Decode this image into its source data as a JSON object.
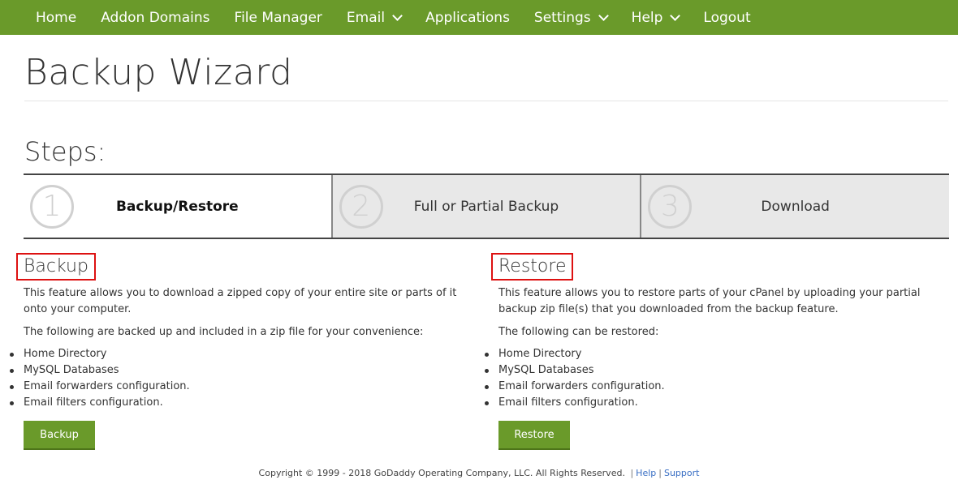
{
  "nav": {
    "items": [
      {
        "label": "Home",
        "dropdown": false
      },
      {
        "label": "Addon Domains",
        "dropdown": false
      },
      {
        "label": "File Manager",
        "dropdown": false
      },
      {
        "label": "Email",
        "dropdown": true
      },
      {
        "label": "Applications",
        "dropdown": false
      },
      {
        "label": "Settings",
        "dropdown": true
      },
      {
        "label": "Help",
        "dropdown": true
      },
      {
        "label": "Logout",
        "dropdown": false
      }
    ],
    "color": "#6a9a2a"
  },
  "page": {
    "title": "Backup Wizard",
    "steps_title": "Steps:"
  },
  "steps": [
    {
      "number": "1",
      "label": "Backup/Restore",
      "active": true
    },
    {
      "number": "2",
      "label": "Full or Partial Backup",
      "active": false
    },
    {
      "number": "3",
      "label": "Download",
      "active": false
    }
  ],
  "backup": {
    "title": "Backup",
    "description": "This feature allows you to download a zipped copy of your entire site or parts of it onto your computer.",
    "subheading": "The following are backed up and included in a zip file for your convenience:",
    "items": [
      "Home Directory",
      "MySQL Databases",
      "Email forwarders configuration.",
      "Email filters configuration."
    ],
    "button_label": "Backup"
  },
  "restore": {
    "title": "Restore",
    "description": "This feature allows you to restore parts of your cPanel by uploading your partial backup zip file(s) that you downloaded from the backup feature.",
    "subheading": "The following can be restored:",
    "items": [
      "Home Directory",
      "MySQL Databases",
      "Email forwarders configuration.",
      "Email filters configuration."
    ],
    "button_label": "Restore"
  },
  "footer": {
    "copyright": "Copyright © 1999 - 2018 GoDaddy Operating Company, LLC. All Rights Reserved.",
    "help_link": "Help",
    "support_link": "Support"
  },
  "colors": {
    "accent": "#6a9a2a",
    "highlight_border": "#dd1111",
    "link": "#3a6fc4"
  }
}
